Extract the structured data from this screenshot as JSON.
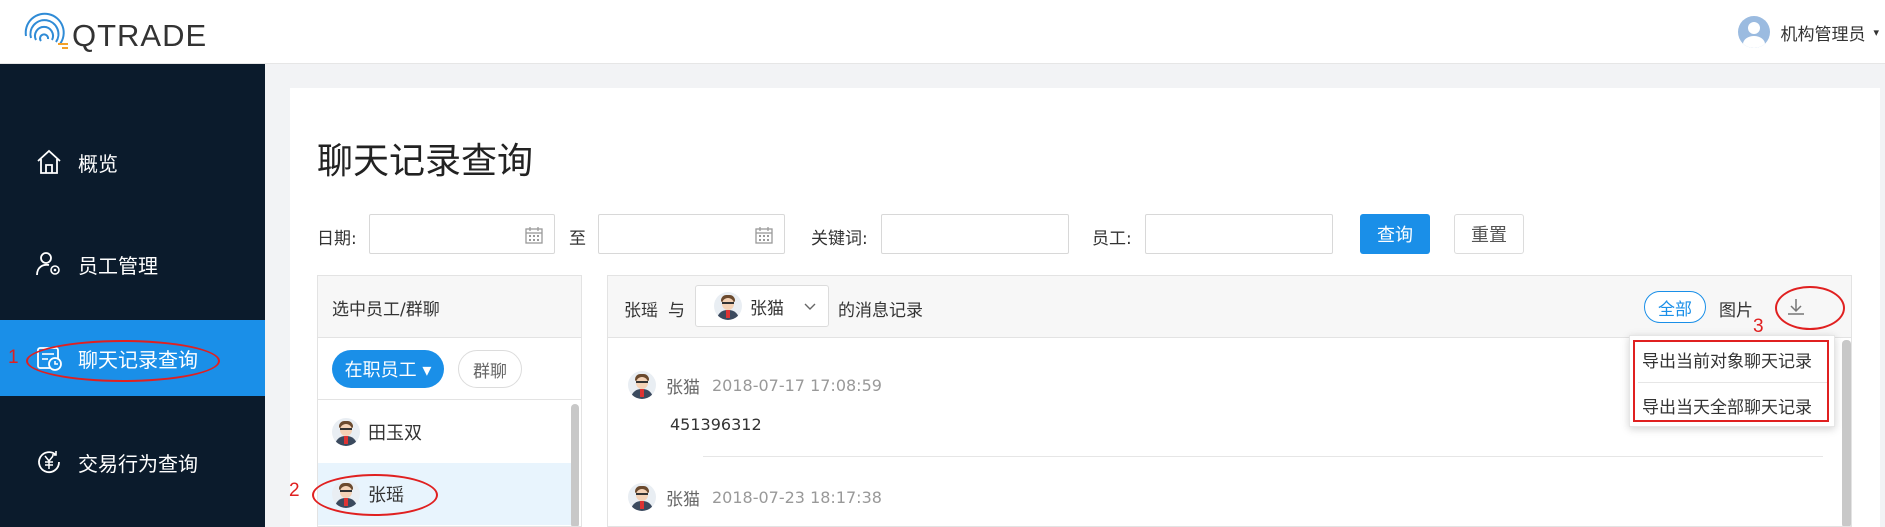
{
  "app": {
    "brand": "QTRADE",
    "user_name": "机构管理员",
    "user_caret": "▾"
  },
  "sidebar": {
    "items": [
      {
        "label": "概览",
        "icon": "home-icon"
      },
      {
        "label": "员工管理",
        "icon": "user-gear-icon"
      },
      {
        "label": "聊天记录查询",
        "icon": "chat-record-icon",
        "active": true
      },
      {
        "label": "交易行为查询",
        "icon": "yen-cycle-icon"
      }
    ]
  },
  "page": {
    "title": "聊天记录查询"
  },
  "filters": {
    "date_label": "日期:",
    "date_sep": "至",
    "keyword_label": "关键词:",
    "employee_label": "员工:",
    "search_button": "查询",
    "reset_button": "重置",
    "date_start_value": "",
    "date_end_value": "",
    "keyword_value": "",
    "employee_value": ""
  },
  "employee_panel": {
    "title": "选中员工/群聊",
    "tab_active": "在职员工 ▾",
    "tab_other": "群聊",
    "items": [
      {
        "name": "田玉双",
        "selected": false
      },
      {
        "name": "张瑶",
        "selected": true
      }
    ]
  },
  "chat_panel": {
    "subject": "张瑶",
    "with_label": "与",
    "contact": "张猫",
    "records_label": "的消息记录",
    "filter_all": "全部",
    "filter_images": "图片",
    "messages": [
      {
        "sender": "张猫",
        "time": "2018-07-17 17:08:59",
        "text": "451396312"
      },
      {
        "sender": "张猫",
        "time": "2018-07-23 18:17:38",
        "text": ""
      }
    ]
  },
  "export_menu": {
    "items": [
      "导出当前对象聊天记录",
      "导出当天全部聊天记录"
    ]
  },
  "annotations": {
    "one": "1",
    "two": "2",
    "three": "3"
  },
  "colors": {
    "primary": "#1a8fe8",
    "sidebar_bg": "#0b1b2c",
    "annotation": "#e02020"
  }
}
